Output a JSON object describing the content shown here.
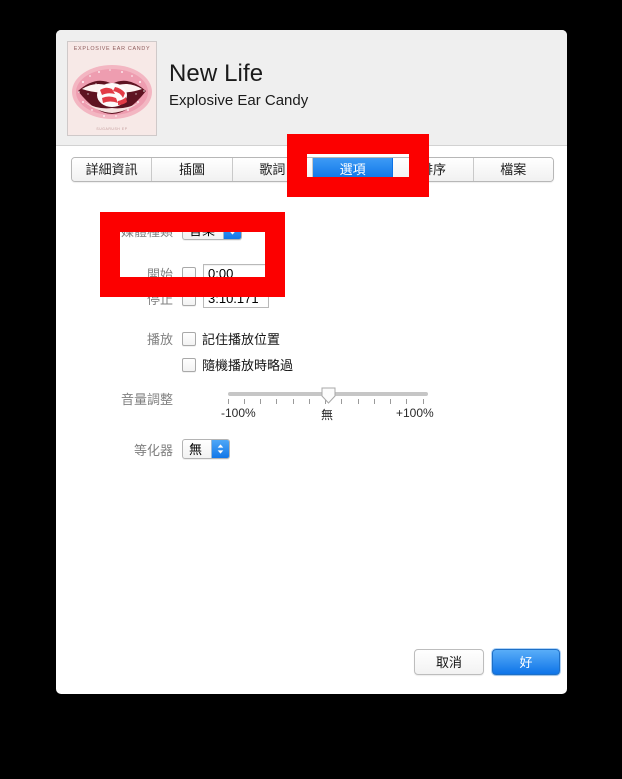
{
  "window": {
    "title": "New Life",
    "subtitle": "Explosive Ear Candy"
  },
  "artwork": {
    "top_text": "EXPLOSIVE EAR CANDY",
    "bottom_text": "SUGARUSH EP",
    "name": "album-artwork"
  },
  "tabs": [
    {
      "label": "詳細資訊",
      "name": "tab-details",
      "selected": false
    },
    {
      "label": "插圖",
      "name": "tab-artwork",
      "selected": false
    },
    {
      "label": "歌詞",
      "name": "tab-lyrics",
      "selected": false
    },
    {
      "label": "選項",
      "name": "tab-options",
      "selected": true
    },
    {
      "label": "排序",
      "name": "tab-sorting",
      "selected": false
    },
    {
      "label": "檔案",
      "name": "tab-file",
      "selected": false
    }
  ],
  "form": {
    "media_kind": {
      "label": "媒體種類",
      "value": "音樂"
    },
    "start": {
      "label": "開始",
      "checked": false,
      "value": "0:00"
    },
    "stop": {
      "label": "停止",
      "checked": false,
      "value": "3:10.171"
    },
    "playback": {
      "label": "播放",
      "remember_position": {
        "label": "記住播放位置",
        "checked": false
      },
      "skip_when_shuffling": {
        "label": "隨機播放時略過",
        "checked": false
      }
    },
    "volume_adjust": {
      "label": "音量調整",
      "min_label": "-100%",
      "mid_label": "無",
      "max_label": "+100%",
      "value": 0,
      "tick_count": 13
    },
    "equalizer": {
      "label": "等化器",
      "value": "無"
    }
  },
  "footer": {
    "cancel_label": "取消",
    "ok_label": "好"
  },
  "annotations": {
    "color": "#fc0000",
    "boxes": [
      {
        "name": "annotation-box-options-tab"
      },
      {
        "name": "annotation-box-start-stop-fields"
      }
    ]
  }
}
